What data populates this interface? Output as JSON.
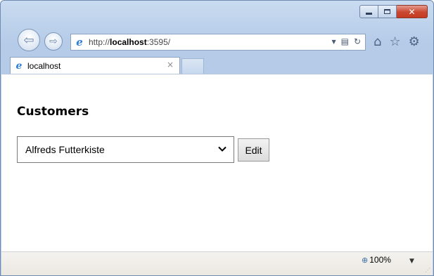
{
  "browser": {
    "address": {
      "url_prefix": "http://",
      "url_host": "localhost",
      "url_suffix": ":3595/"
    },
    "tab": {
      "title": "localhost",
      "close_glyph": "×"
    },
    "icons": {
      "back": "back-arrow-icon",
      "forward": "forward-arrow-icon",
      "ie_logo": "ie-logo-icon",
      "dropdown": "dropdown-arrow-icon",
      "compat": "compatibility-view-icon",
      "refresh": "refresh-icon",
      "home": "home-icon",
      "favorites": "star-icon",
      "tools": "gear-icon",
      "zoom": "zoom-icon"
    },
    "window_controls": {
      "close_glyph": "✕"
    }
  },
  "page": {
    "title": "Customers",
    "customer_select": {
      "selected": "Alfreds Futterkiste"
    },
    "edit_label": "Edit"
  },
  "status": {
    "zoom": "100%"
  },
  "colors": {
    "frame": "#b5cbe8",
    "close_button": "#c9472f",
    "ie_blue": "#2f7fd6"
  }
}
